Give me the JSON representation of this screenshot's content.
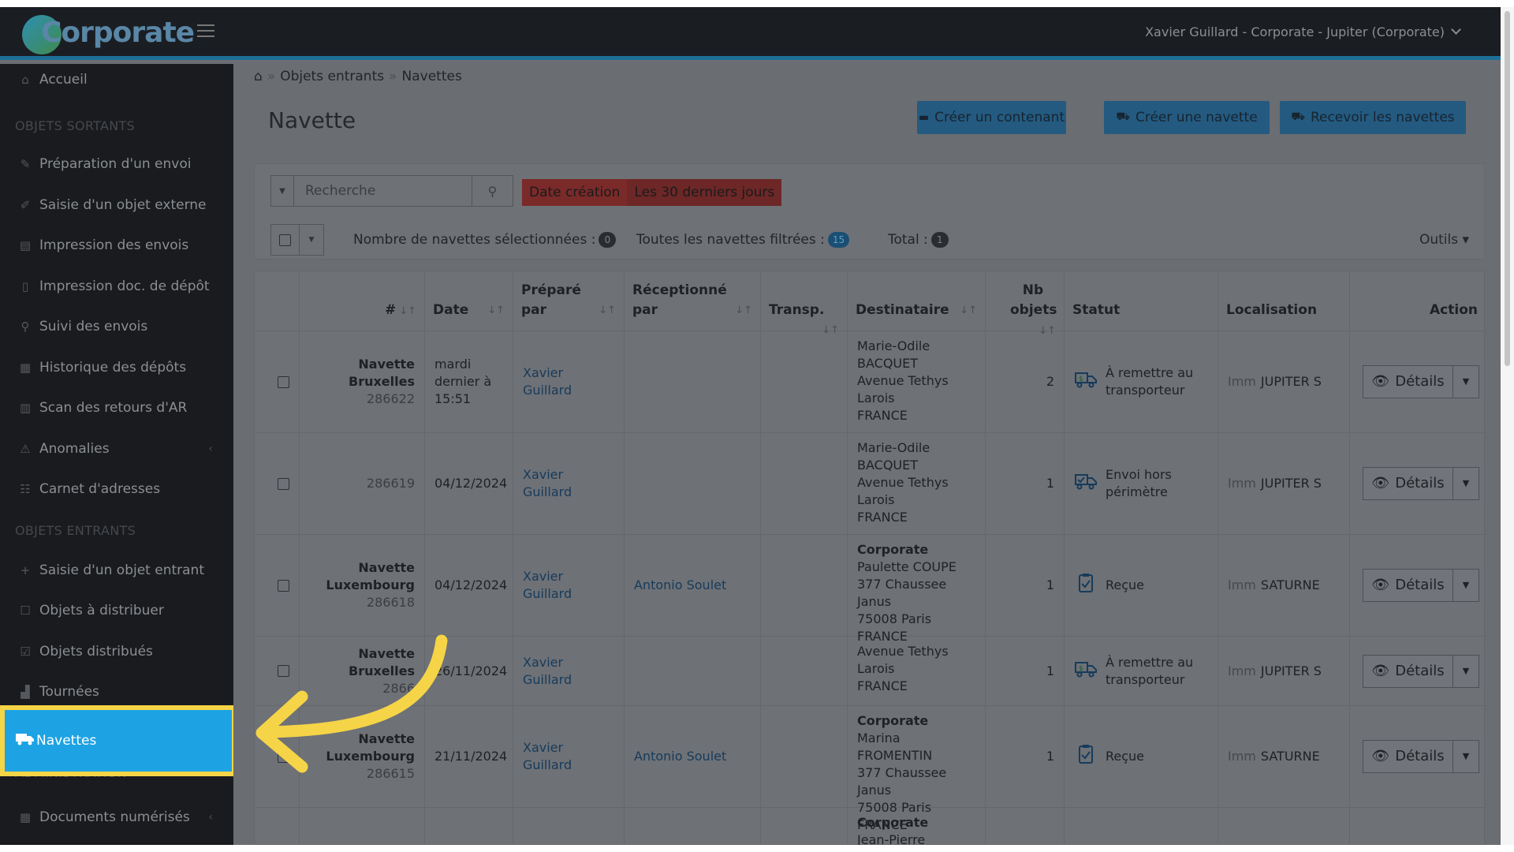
{
  "header": {
    "logo_text": "Corporate",
    "user": "Xavier Guillard - Corporate - Jupiter (Corporate)"
  },
  "sidebar": {
    "home": "Accueil",
    "section_out": "OBJETS SORTANTS",
    "out_items": [
      "Préparation d'un envoi",
      "Saisie d'un objet externe",
      "Impression des envois",
      "Impression doc. de dépôt",
      "Suivi des envois",
      "Historique des dépôts",
      "Scan des retours d'AR",
      "Anomalies",
      "Carnet d'adresses"
    ],
    "section_in": "OBJETS ENTRANTS",
    "in_items": [
      "Saisie d'un objet entrant",
      "Objets à distribuer",
      "Objets distribués",
      "Tournées"
    ],
    "active": "Navettes",
    "section_admin": "ADMINISTRATION",
    "admin_items": [
      "Documents numérisés"
    ]
  },
  "breadcrumb": [
    "Objets entrants",
    "Navettes"
  ],
  "page_title": "Navette",
  "toolbar": {
    "create_container": "Créer un contenant",
    "create_shuttle": "Créer une navette",
    "receive_shuttles": "Recevoir les navettes"
  },
  "filters": {
    "search_placeholder": "Recherche",
    "date_key": "Date création",
    "date_value": "Les 30 derniers jours",
    "selected_label": "Nombre de navettes sélectionnées :",
    "selected_count": "0",
    "filtered_label": "Toutes les navettes filtrées :",
    "filtered_count": "15",
    "total_label": "Total :",
    "total_count": "1",
    "tools": "Outils"
  },
  "table": {
    "headers": [
      "#",
      "Date",
      "Préparé par",
      "Réceptionné par",
      "Transp.",
      "Destinataire",
      "Nb objets",
      "Statut",
      "Localisation",
      "Action"
    ],
    "rows": [
      {
        "name": "Navette Bruxelles",
        "id": "286622",
        "date": "mardi dernier à 15:51",
        "prepared": "Xavier Guillard",
        "received": "",
        "transp": "",
        "dest": [
          "Marie-Odile",
          "BACQUET",
          "Avenue Tethys",
          "Larois",
          "FRANCE"
        ],
        "nb": "2",
        "status": "À remettre au transporteur",
        "status_icon": "truck-money-icon",
        "imm": "Imm",
        "loc": "JUPITER S",
        "action": "Détails"
      },
      {
        "name": "",
        "id": "286619",
        "date": "04/12/2024",
        "prepared": "Xavier Guillard",
        "received": "",
        "transp": "",
        "dest": [
          "Marie-Odile",
          "BACQUET",
          "Avenue Tethys",
          "Larois",
          "FRANCE"
        ],
        "nb": "1",
        "status": "Envoi hors périmètre",
        "status_icon": "truck-check-icon",
        "imm": "Imm",
        "loc": "JUPITER S",
        "action": "Détails"
      },
      {
        "name": "Navette Luxembourg",
        "id": "286618",
        "date": "04/12/2024",
        "prepared": "Xavier Guillard",
        "received": "Antonio Soulet",
        "transp": "",
        "dest_company": "Corporate",
        "dest": [
          "Paulette COUPE",
          "377 Chaussee Janus",
          "75008 Paris",
          "FRANCE"
        ],
        "nb": "1",
        "status": "Reçue",
        "status_icon": "clipboard-check-icon",
        "imm": "Imm",
        "loc": "SATURNE",
        "action": "Détails"
      },
      {
        "name": "Navette Bruxelles",
        "id": "2866",
        "date": "26/11/2024",
        "prepared": "Xavier Guillard",
        "received": "",
        "transp": "",
        "dest": [
          "Avenue Tethys",
          "Larois",
          "FRANCE"
        ],
        "nb": "1",
        "status": "À remettre au transporteur",
        "status_icon": "truck-money-icon",
        "imm": "Imm",
        "loc": "JUPITER S",
        "action": "Détails"
      },
      {
        "name": "Navette Luxembourg",
        "id": "286615",
        "date": "21/11/2024",
        "prepared": "Xavier Guillard",
        "received": "Antonio Soulet",
        "transp": "",
        "dest_company": "Corporate",
        "dest": [
          "Marina FROMENTIN",
          "377 Chaussee Janus",
          "75008 Paris",
          "FRANCE"
        ],
        "nb": "1",
        "status": "Reçue",
        "status_icon": "clipboard-check-icon",
        "imm": "Imm",
        "loc": "SATURNE",
        "action": "Détails"
      },
      {
        "dest_company": "Corporate",
        "dest": [
          "Jean-Pierre BRISSET"
        ]
      }
    ]
  },
  "colors": {
    "highlight": "#f5d447",
    "active_nav": "#1da3e4",
    "accent_bar": "#1d6f97"
  }
}
